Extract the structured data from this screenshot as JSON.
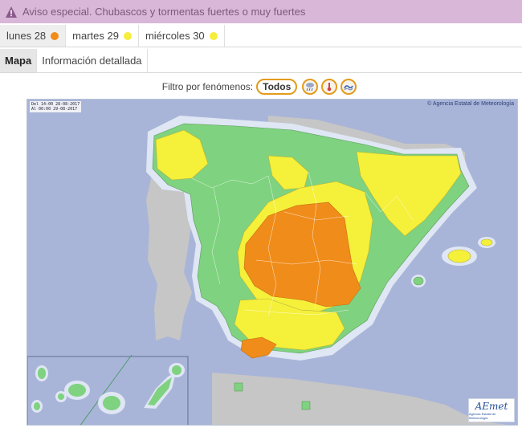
{
  "banner": {
    "text": "Aviso especial. Chubascos y tormentas fuertes o muy fuertes",
    "icon": "warning-triangle-icon",
    "background": "#d9b7d9"
  },
  "days": [
    {
      "label": "lunes 28",
      "level_color": "#f08c1a",
      "active": true
    },
    {
      "label": "martes 29",
      "level_color": "#f7ed3c",
      "active": false
    },
    {
      "label": "miércoles 30",
      "level_color": "#f7ed3c",
      "active": false
    }
  ],
  "views": [
    {
      "label": "Mapa",
      "active": true
    },
    {
      "label": "Información detallada",
      "active": false
    }
  ],
  "filter": {
    "label": "Filtro por fenómenos:",
    "all": "Todos",
    "icons": [
      "rain-storm-icon",
      "thermometer-icon",
      "wave-icon"
    ]
  },
  "map": {
    "validity_from": "Del 14:00 28-08-2017",
    "validity_to": "Al  00:00 29-08-2017",
    "credit": "Agencia Estatal de Meteorología",
    "logo_text": "AEmet",
    "logo_sub": "Agencia Estatal de Meteorología",
    "colors": {
      "sea": "#a9b5d8",
      "land_foreign": "#c6c6c6",
      "green": "#7fd27f",
      "yellow": "#f5f03a",
      "orange": "#f08c1a",
      "coast_halo": "#dfe6f4"
    }
  }
}
